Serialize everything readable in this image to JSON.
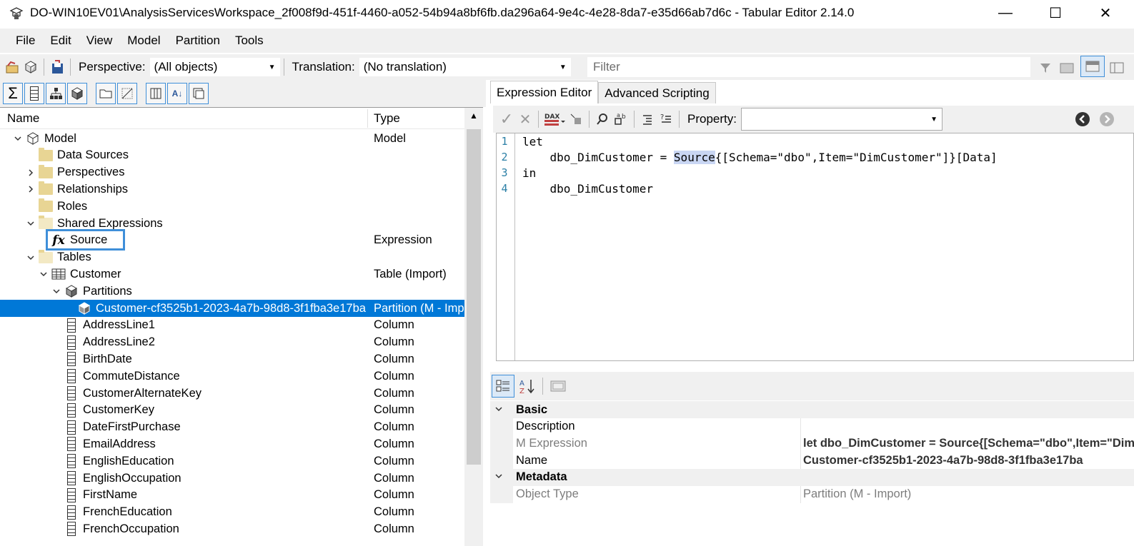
{
  "window": {
    "title": "DO-WIN10EV01\\AnalysisServicesWorkspace_2f008f9d-451f-4460-a052-54b94a8bf6fb.da296a64-9e4c-4e28-8da7-e35d66ab7d6c - Tabular Editor 2.14.0",
    "minimize_glyph": "—",
    "maximize_glyph": "☐",
    "close_glyph": "✕"
  },
  "menu": [
    "File",
    "Edit",
    "View",
    "Model",
    "Partition",
    "Tools"
  ],
  "toolbar": {
    "perspective_label": "Perspective:",
    "perspective_value": "(All objects)",
    "translation_label": "Translation:",
    "translation_value": "(No translation)",
    "filter_placeholder": "Filter"
  },
  "tree": {
    "header_name": "Name",
    "header_type": "Type",
    "rows": [
      {
        "name": "Model",
        "type": "Model",
        "indent": 0,
        "icon": "cube-icon",
        "expander": "open"
      },
      {
        "name": "Data Sources",
        "type": "",
        "indent": 1,
        "icon": "folder-icon",
        "expander": "none"
      },
      {
        "name": "Perspectives",
        "type": "",
        "indent": 1,
        "icon": "folder-icon",
        "expander": "closed"
      },
      {
        "name": "Relationships",
        "type": "",
        "indent": 1,
        "icon": "folder-icon",
        "expander": "closed"
      },
      {
        "name": "Roles",
        "type": "",
        "indent": 1,
        "icon": "folder-icon",
        "expander": "none"
      },
      {
        "name": "Shared Expressions",
        "type": "",
        "indent": 1,
        "icon": "folder-open-icon",
        "expander": "open"
      },
      {
        "name": "Source",
        "type": "Expression",
        "indent": 2,
        "icon": "fx-icon",
        "expander": "none"
      },
      {
        "name": "Tables",
        "type": "",
        "indent": 1,
        "icon": "folder-open-icon",
        "expander": "open"
      },
      {
        "name": "Customer",
        "type": "Table (Import)",
        "indent": 2,
        "icon": "table-icon",
        "expander": "open"
      },
      {
        "name": "Partitions",
        "type": "",
        "indent": 3,
        "icon": "partitions-icon",
        "expander": "open"
      },
      {
        "name": "Customer-cf3525b1-2023-4a7b-98d8-3f1fba3e17ba",
        "type": "Partition (M - Import)",
        "indent": 4,
        "icon": "partition-icon",
        "expander": "none",
        "selected": true
      },
      {
        "name": "AddressLine1",
        "type": "Column",
        "indent": 3,
        "icon": "column-icon",
        "expander": "none"
      },
      {
        "name": "AddressLine2",
        "type": "Column",
        "indent": 3,
        "icon": "column-icon",
        "expander": "none"
      },
      {
        "name": "BirthDate",
        "type": "Column",
        "indent": 3,
        "icon": "column-icon",
        "expander": "none"
      },
      {
        "name": "CommuteDistance",
        "type": "Column",
        "indent": 3,
        "icon": "column-icon",
        "expander": "none"
      },
      {
        "name": "CustomerAlternateKey",
        "type": "Column",
        "indent": 3,
        "icon": "column-icon",
        "expander": "none"
      },
      {
        "name": "CustomerKey",
        "type": "Column",
        "indent": 3,
        "icon": "column-icon",
        "expander": "none"
      },
      {
        "name": "DateFirstPurchase",
        "type": "Column",
        "indent": 3,
        "icon": "column-icon",
        "expander": "none"
      },
      {
        "name": "EmailAddress",
        "type": "Column",
        "indent": 3,
        "icon": "column-icon",
        "expander": "none"
      },
      {
        "name": "EnglishEducation",
        "type": "Column",
        "indent": 3,
        "icon": "column-icon",
        "expander": "none"
      },
      {
        "name": "EnglishOccupation",
        "type": "Column",
        "indent": 3,
        "icon": "column-icon",
        "expander": "none"
      },
      {
        "name": "FirstName",
        "type": "Column",
        "indent": 3,
        "icon": "column-icon",
        "expander": "none"
      },
      {
        "name": "FrenchEducation",
        "type": "Column",
        "indent": 3,
        "icon": "column-icon",
        "expander": "none"
      },
      {
        "name": "FrenchOccupation",
        "type": "Column",
        "indent": 3,
        "icon": "column-icon",
        "expander": "none"
      }
    ]
  },
  "tabs": [
    "Expression Editor",
    "Advanced Scripting"
  ],
  "editor": {
    "property_label": "Property:",
    "lines": [
      {
        "num": "1",
        "pre": "let",
        "hl": "",
        "post": ""
      },
      {
        "num": "2",
        "pre": "    dbo_DimCustomer = ",
        "hl": "Source",
        "post": "{[Schema=\"dbo\",Item=\"DimCustomer\"]}[Data]"
      },
      {
        "num": "3",
        "pre": "in",
        "hl": "",
        "post": ""
      },
      {
        "num": "4",
        "pre": "    dbo_DimCustomer",
        "hl": "",
        "post": ""
      }
    ]
  },
  "properties": {
    "rows": [
      {
        "kind": "category",
        "key": "Basic",
        "value": ""
      },
      {
        "kind": "prop",
        "key": "Description",
        "value": "",
        "style": "normal"
      },
      {
        "kind": "prop",
        "key": "M Expression",
        "value": "let     dbo_DimCustomer = Source{[Schema=\"dbo\",Item=\"DimCustomer\"]}[Data]",
        "style": "bold-grey"
      },
      {
        "kind": "prop",
        "key": "Name",
        "value": "Customer-cf3525b1-2023-4a7b-98d8-3f1fba3e17ba",
        "style": "bold"
      },
      {
        "kind": "category",
        "key": "Metadata",
        "value": ""
      },
      {
        "kind": "prop",
        "key": "Object Type",
        "value": "Partition (M - Import)",
        "style": "grey"
      }
    ]
  },
  "colors": {
    "selection": "#0078d7",
    "highlight_box": "#3f8fd9",
    "line_number": "#2b7fa6"
  }
}
